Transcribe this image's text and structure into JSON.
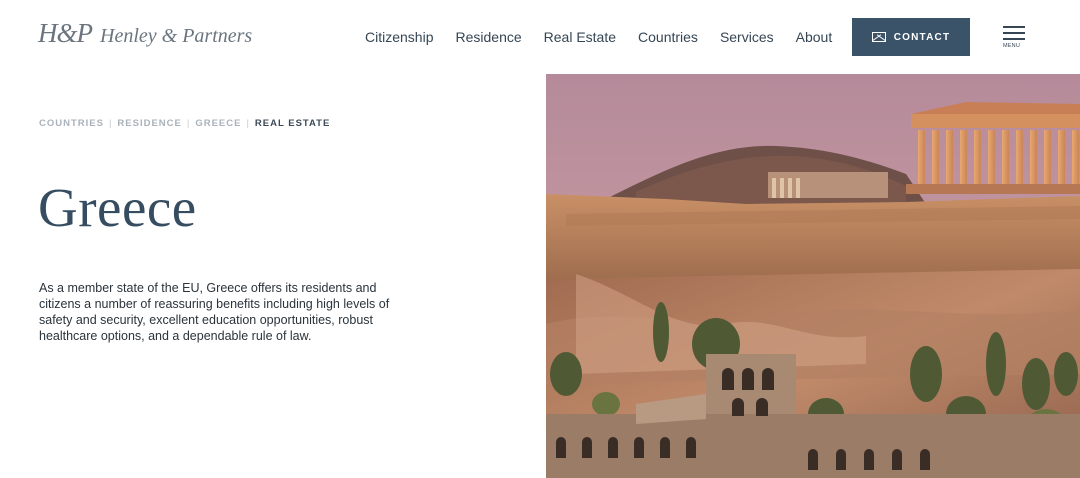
{
  "brand": {
    "mark": "H&P",
    "name": "Henley & Partners"
  },
  "nav": {
    "items": [
      {
        "label": "Citizenship"
      },
      {
        "label": "Residence"
      },
      {
        "label": "Real Estate"
      },
      {
        "label": "Countries"
      },
      {
        "label": "Services"
      },
      {
        "label": "About"
      }
    ],
    "contact_label": "CONTACT",
    "menu_label": "MENU"
  },
  "breadcrumb": {
    "items": [
      "COUNTRIES",
      "RESIDENCE",
      "GREECE"
    ],
    "current": "REAL ESTATE"
  },
  "page": {
    "title": "Greece",
    "intro": "As a member state of the EU, Greece offers its residents and citizens a number of reassuring benefits including high levels of safety and security, excellent education opportunities, robust healthcare options, and a dependable rule of law."
  },
  "icons": {
    "contact": "mail-icon",
    "menu": "hamburger-menu-icon"
  },
  "colors": {
    "accent": "#3a5368",
    "title": "#364c60",
    "breadcrumb_muted": "#a9b2ba"
  }
}
